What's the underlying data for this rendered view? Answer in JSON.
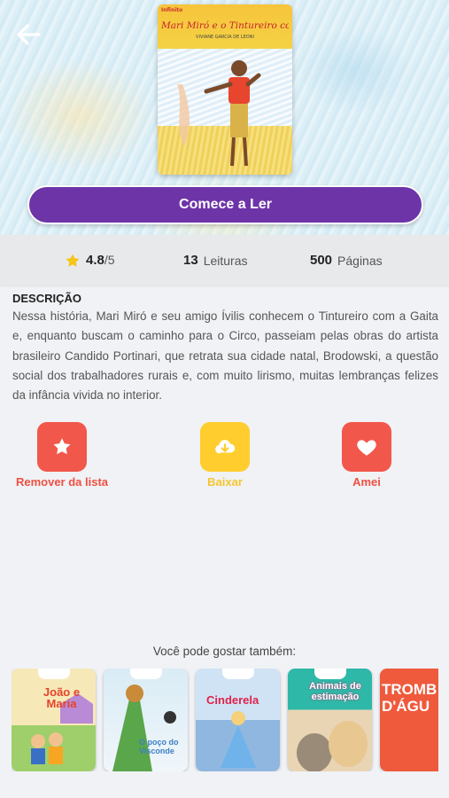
{
  "hero": {
    "cover": {
      "publisher": "Infinito",
      "title": "Mari Miró e o Tintureiro com a Gaita",
      "author": "VIVIANE GARCIA DE LEONI"
    },
    "cta_label": "Comece a Ler"
  },
  "stats": {
    "rating": "4.8",
    "rating_max": "/5",
    "reads_count": "13",
    "reads_label": "Leituras",
    "pages_count": "500",
    "pages_label": "Páginas"
  },
  "description": {
    "title": "DESCRIÇÃO",
    "text": "Nessa história, Mari Miró e seu amigo Ívilis conhecem o Tintureiro com a Gaita e, enquanto buscam o caminho para o Circo, passeiam pelas obras do artista brasileiro Candido Portinari, que retrata sua cidade natal, Brodowski, a questão social dos trabalhadores rurais e, com muito lirismo, muitas lembranças felizes da infância vivida no interior."
  },
  "actions": {
    "remove_label": "Remover da lista",
    "download_label": "Baixar",
    "love_label": "Amei"
  },
  "suggestions": {
    "title": "Você pode gostar também:",
    "books": [
      {
        "title": "João e Maria"
      },
      {
        "title": "O poço do Visconde"
      },
      {
        "title": "Cinderela"
      },
      {
        "title": "Animais de estimação"
      },
      {
        "title": "TROMB D'ÁGU"
      }
    ]
  },
  "colors": {
    "primary_purple": "#6d34a8",
    "red": "#f2574b",
    "yellow": "#ffcd2e"
  },
  "icons": [
    "back-arrow-icon",
    "star-icon",
    "cloud-download-icon",
    "heart-icon"
  ]
}
